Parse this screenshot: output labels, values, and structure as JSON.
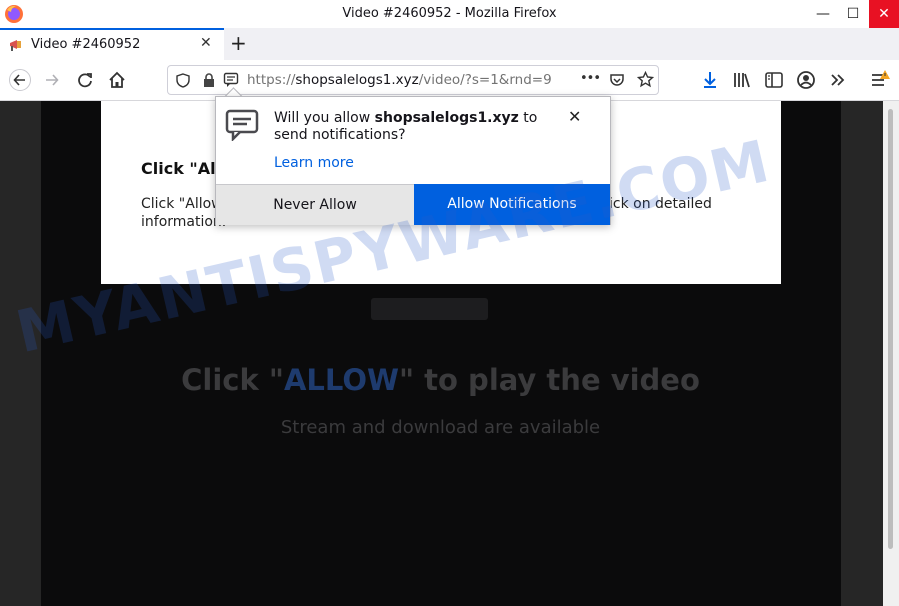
{
  "window": {
    "title": "Video #2460952 - Mozilla Firefox",
    "minimize": "—",
    "maximize": "☐",
    "close": "✕"
  },
  "tabs": [
    {
      "label": "Video #2460952",
      "close": "✕"
    }
  ],
  "newtab_label": "+",
  "urlbar": {
    "scheme": "https://",
    "host": "shopsalelogs1.xyz",
    "path": "/video/?s=1&rnd=9",
    "more": "•••"
  },
  "page": {
    "heading": "Click \"Al",
    "text_line1": "Click \"Allow",
    "text_line2": "information.",
    "text_right": "ick on detailed",
    "play_prefix": "Click \"",
    "play_allow": "ALLOW",
    "play_suffix": "\" to play the video",
    "stream_text": "Stream and download are available"
  },
  "popup": {
    "question_prefix": "Will you allow ",
    "question_host": "shopsalelogs1.xyz",
    "question_suffix": " to",
    "question_line2": "send notifications?",
    "learn_more": "Learn more",
    "close": "✕",
    "never_allow": "Never Allow",
    "allow_notifications": "Allow Notifications"
  },
  "watermark": "MYANTISPYWARE.COM",
  "colors": {
    "accent": "#0060df",
    "page_dark": "#0b0b0c",
    "close_red": "#e81123"
  }
}
